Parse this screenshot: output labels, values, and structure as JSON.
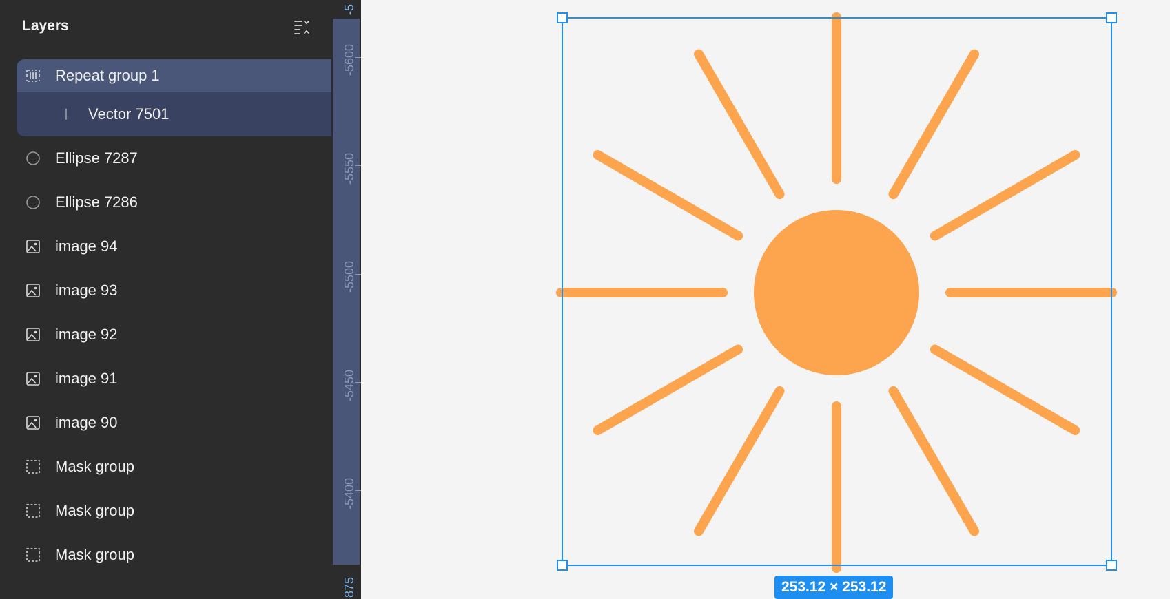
{
  "panel": {
    "title": "Layers",
    "menu_icon": "list-collapse-icon"
  },
  "layers": [
    {
      "label": "Repeat group 1",
      "icon": "repeat-group-icon"
    },
    {
      "label": "Vector 7501",
      "icon": "vector-line-icon"
    },
    {
      "label": "Ellipse 7287",
      "icon": "ellipse-icon"
    },
    {
      "label": "Ellipse 7286",
      "icon": "ellipse-icon"
    },
    {
      "label": "image 94",
      "icon": "image-icon"
    },
    {
      "label": "image 93",
      "icon": "image-icon"
    },
    {
      "label": "image 92",
      "icon": "image-icon"
    },
    {
      "label": "image 91",
      "icon": "image-icon"
    },
    {
      "label": "image 90",
      "icon": "image-icon"
    },
    {
      "label": "Mask group",
      "icon": "mask-group-icon"
    },
    {
      "label": "Mask group",
      "icon": "mask-group-icon"
    },
    {
      "label": "Mask group",
      "icon": "mask-group-icon"
    }
  ],
  "ruler": {
    "top_edge": "-5",
    "labels": [
      "-5600",
      "-5550",
      "-5500",
      "-5450",
      "-5400"
    ],
    "bottom_edge": "875"
  },
  "selection": {
    "dimensions": "253.12 × 253.12"
  },
  "colors": {
    "panel_bg": "#2c2c2c",
    "selected_row": "#4a5778",
    "selected_group": "#394260",
    "sun_color": "#fca54e",
    "selection_blue": "#1e8ff0"
  }
}
